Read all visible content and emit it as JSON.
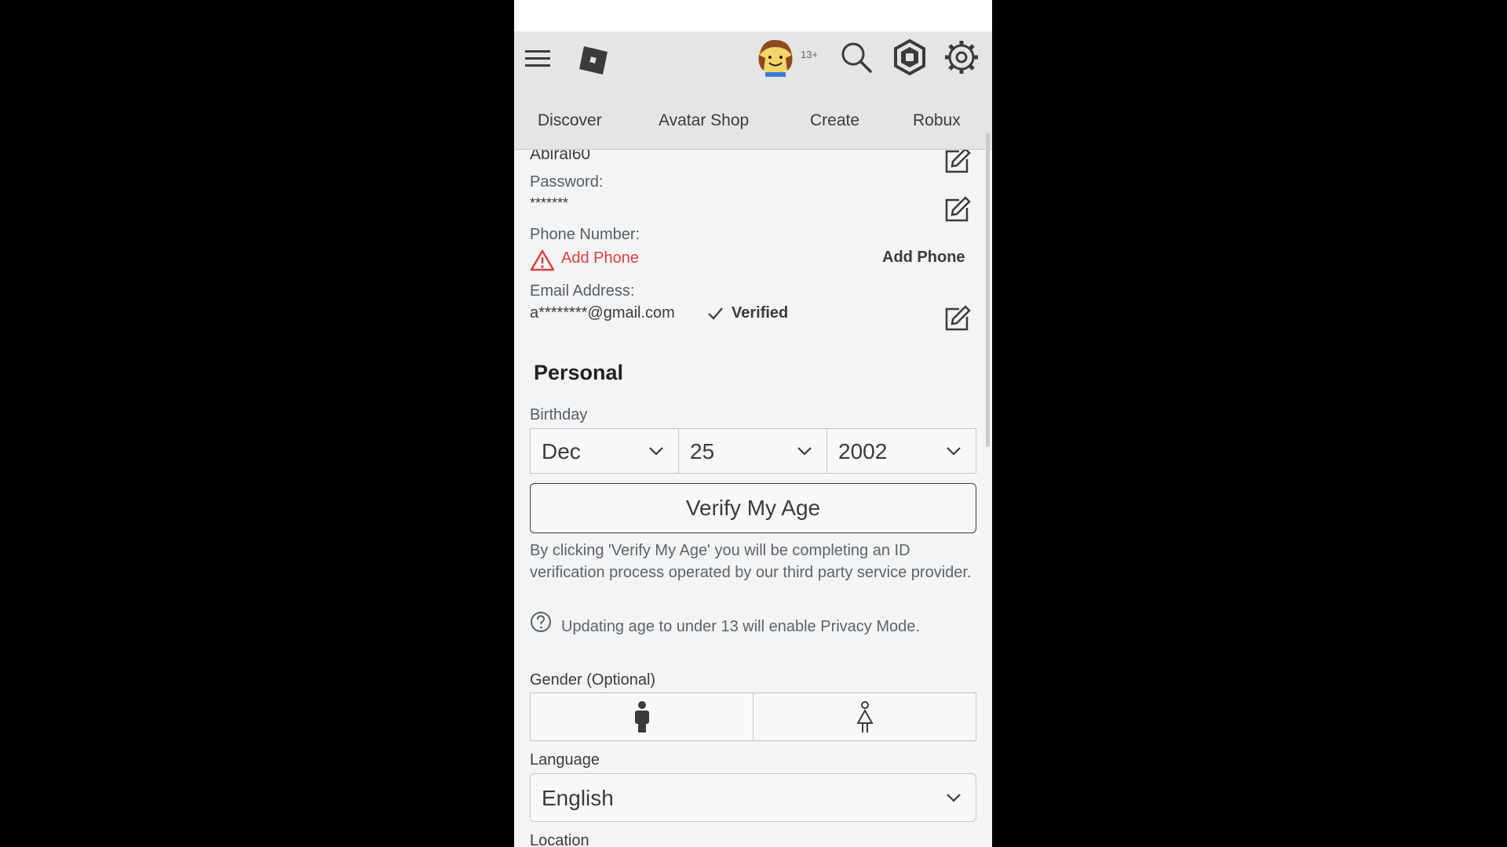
{
  "nav": {
    "tabs": [
      "Discover",
      "Avatar Shop",
      "Create",
      "Robux"
    ],
    "age_badge": "13+",
    "icons": [
      "hamburger-menu-icon",
      "roblox-logo-icon",
      "avatar-icon",
      "search-icon",
      "robux-icon",
      "gear-icon"
    ]
  },
  "account": {
    "username": "Abiral60",
    "password_label": "Password:",
    "password_value": "*******",
    "phone_label": "Phone Number:",
    "phone_warning": "Add Phone",
    "phone_action": "Add Phone",
    "email_label": "Email Address:",
    "email_value": "a********@gmail.com",
    "email_status": "Verified"
  },
  "personal": {
    "heading": "Personal",
    "birthday_label": "Birthday",
    "birthday_month": "Dec",
    "birthday_day": "25",
    "birthday_year": "2002",
    "verify_button": "Verify My Age",
    "verify_note": "By clicking 'Verify My Age' you will be completing an ID verification process operated by our third party service provider.",
    "privacy_note": "Updating age to under 13 will enable Privacy Mode.",
    "gender_label": "Gender (Optional)",
    "language_label": "Language",
    "language_value": "English",
    "location_label": "Location"
  },
  "colors": {
    "warning": "#e03e3e",
    "nav_bg": "#e3e5e6",
    "page_bg": "#f2f4f5"
  }
}
